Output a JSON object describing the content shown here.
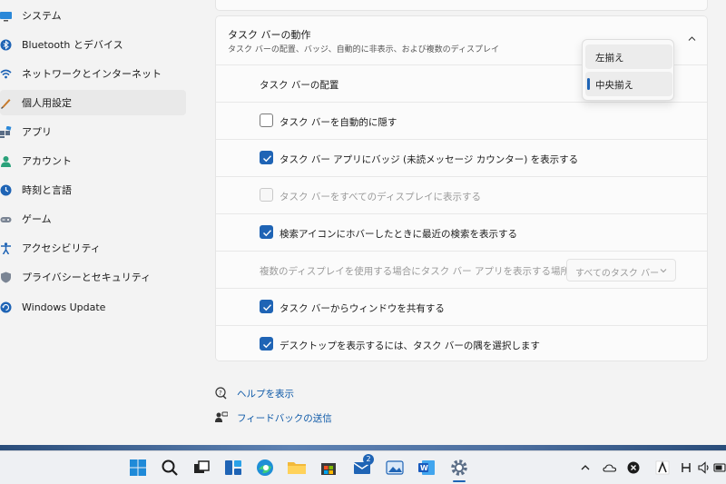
{
  "sidebar": {
    "items": [
      {
        "label": "システム",
        "icon": "display-icon"
      },
      {
        "label": "Bluetooth とデバイス",
        "icon": "bluetooth-icon"
      },
      {
        "label": "ネットワークとインターネット",
        "icon": "wifi-icon"
      },
      {
        "label": "個人用設定",
        "icon": "brush-icon",
        "selected": true
      },
      {
        "label": "アプリ",
        "icon": "apps-icon"
      },
      {
        "label": "アカウント",
        "icon": "person-icon"
      },
      {
        "label": "時刻と言語",
        "icon": "globe-clock-icon"
      },
      {
        "label": "ゲーム",
        "icon": "gamepad-icon"
      },
      {
        "label": "アクセシビリティ",
        "icon": "accessibility-icon"
      },
      {
        "label": "プライバシーとセキュリティ",
        "icon": "shield-icon"
      },
      {
        "label": "Windows Update",
        "icon": "refresh-icon"
      }
    ]
  },
  "taskbar_behavior": {
    "title": "タスク バーの動作",
    "subtitle": "タスク バーの配置、バッジ、自動的に非表示、および複数のディスプレイ",
    "alignment_label": "タスク バーの配置",
    "options": [
      {
        "label": "タスク バーを自動的に隠す",
        "checked": false,
        "disabled": false
      },
      {
        "label": "タスク バー アプリにバッジ (未読メッセージ カウンター) を表示する",
        "checked": true,
        "disabled": false
      },
      {
        "label": "タスク バーをすべてのディスプレイに表示する",
        "checked": false,
        "disabled": true
      },
      {
        "label": "検索アイコンにホバーしたときに最近の検索を表示する",
        "checked": true,
        "disabled": false
      }
    ],
    "multi_display_label": "複数のディスプレイを使用する場合にタスク バー アプリを表示する場所",
    "multi_display_value": "すべてのタスク バー",
    "share_window_label": "タスク バーからウィンドウを共有する",
    "share_window_checked": true,
    "desktop_corner_label": "デスクトップを表示するには、タスク バーの隅を選択します",
    "desktop_corner_checked": true
  },
  "alignment_dropdown": {
    "options": [
      "左揃え",
      "中央揃え"
    ],
    "selected": "中央揃え"
  },
  "links": {
    "help": "ヘルプを表示",
    "feedback": "フィードバックの送信"
  },
  "taskbar": {
    "mail_badge": "2",
    "accent": "#1f64b5"
  }
}
